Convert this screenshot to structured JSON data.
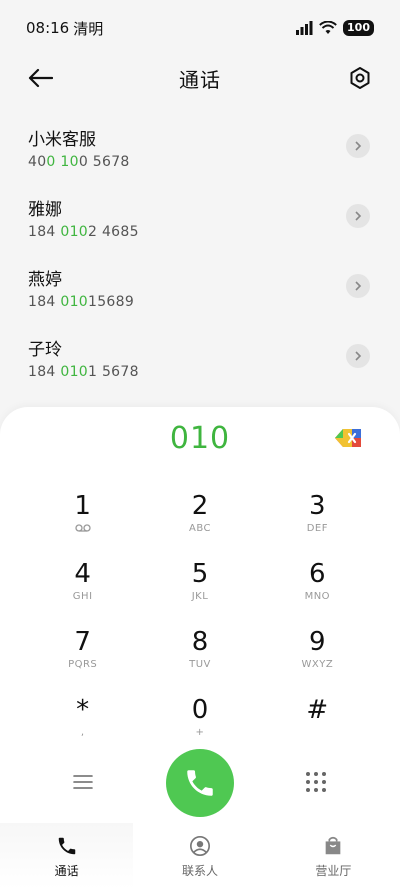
{
  "status": {
    "time": "08:16",
    "weather": "清明",
    "battery": "100"
  },
  "header": {
    "title": "通话"
  },
  "contacts": [
    {
      "name": "小米客服",
      "num_pre": "40",
      "num_hl1": "0",
      "num_mid": " ",
      "num_hl2": "10",
      "num_post": "0 5678"
    },
    {
      "name": "雅娜",
      "num_pre": "184 ",
      "num_hl1": "010",
      "num_mid": "",
      "num_hl2": "",
      "num_post": "2 4685"
    },
    {
      "name": "燕婷",
      "num_pre": "184 ",
      "num_hl1": "010",
      "num_mid": "",
      "num_hl2": "",
      "num_post": "15689"
    },
    {
      "name": "子玲",
      "num_pre": "184 ",
      "num_hl1": "010",
      "num_mid": "",
      "num_hl2": "",
      "num_post": "1 5678"
    }
  ],
  "dialer": {
    "input": "010"
  },
  "keys": [
    {
      "digit": "1",
      "sub": ""
    },
    {
      "digit": "2",
      "sub": "ABC"
    },
    {
      "digit": "3",
      "sub": "DEF"
    },
    {
      "digit": "4",
      "sub": "GHI"
    },
    {
      "digit": "5",
      "sub": "JKL"
    },
    {
      "digit": "6",
      "sub": "MNO"
    },
    {
      "digit": "7",
      "sub": "PQRS"
    },
    {
      "digit": "8",
      "sub": "TUV"
    },
    {
      "digit": "9",
      "sub": "WXYZ"
    },
    {
      "digit": "*",
      "sub": ","
    },
    {
      "digit": "0",
      "sub": "+"
    },
    {
      "digit": "#",
      "sub": ""
    }
  ],
  "nav": {
    "calls": "通话",
    "contacts": "联系人",
    "store": "营业厅"
  },
  "colors": {
    "accent": "#4fc852",
    "highlight": "#3fb53f"
  }
}
